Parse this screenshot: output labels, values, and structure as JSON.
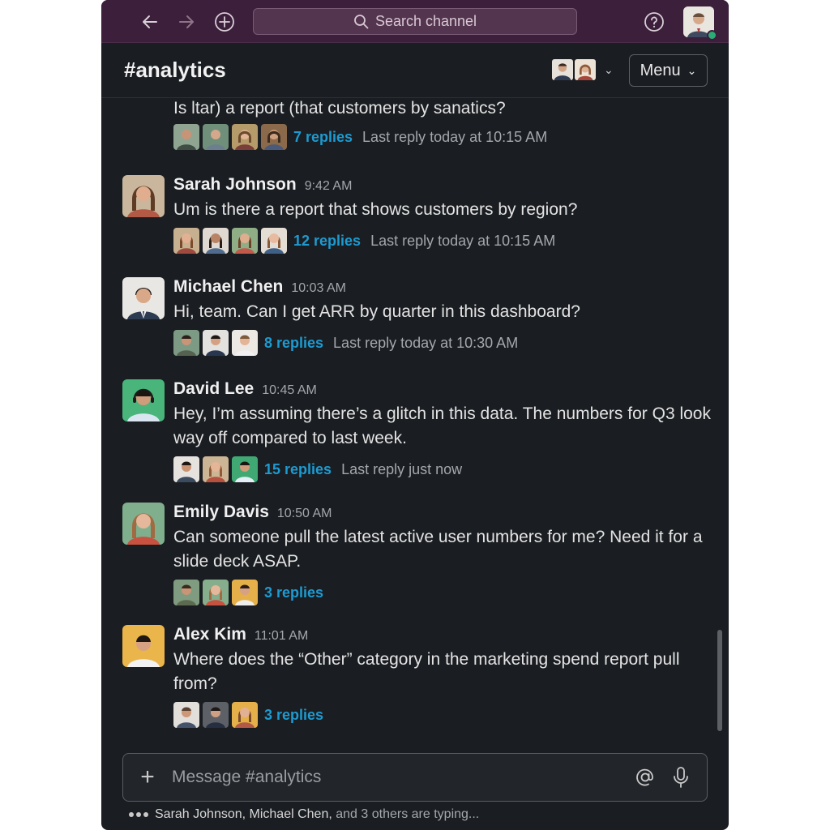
{
  "topbar": {
    "search_placeholder": "Search channel",
    "icons": [
      "arrow-left-icon",
      "arrow-right-icon",
      "plus-circle-icon",
      "search-icon",
      "help-icon"
    ]
  },
  "header": {
    "channel": "#analytics",
    "menu_label": "Menu"
  },
  "messages": [
    {
      "author": "",
      "time": "",
      "text": "Is ltar) a report (that customers by sanatics?",
      "replies": "7 replies",
      "last_reply": "Last reply today at 10:15 AM"
    },
    {
      "author": "Sarah Johnson",
      "time": "9:42 AM",
      "text": "Um is there a report that shows customers by region?",
      "replies": "12 replies",
      "last_reply": "Last reply today at 10:15 AM"
    },
    {
      "author": "Michael Chen",
      "time": "10:03 AM",
      "text": "Hi, team. Can I get ARR by quarter in this dashboard?",
      "replies": "8 replies",
      "last_reply": "Last reply today at 10:30 AM"
    },
    {
      "author": "David Lee",
      "time": "10:45 AM",
      "text": "Hey, I’m assuming there’s a glitch in this data. The numbers for Q3 look way off compared to last week.",
      "replies": "15 replies",
      "last_reply": "Last reply just now"
    },
    {
      "author": "Emily Davis",
      "time": "10:50 AM",
      "text": "Can someone pull the latest active user numbers for me? Need it for a slide deck ASAP.",
      "replies": "3 replies",
      "last_reply": ""
    },
    {
      "author": "Alex Kim",
      "time": "11:01 AM",
      "text": "Where does the “Other” category in the marketing spend report pull from?",
      "replies": "3 replies",
      "last_reply": ""
    }
  ],
  "composer": {
    "placeholder": "Message #analytics"
  },
  "typing": {
    "names": "Sarah Johnson, Michael Chen,",
    "rest": "and 3 others are typing..."
  },
  "colors": {
    "topbar": "#3b1f3b",
    "background": "#1a1d21",
    "link": "#1d9bd1",
    "presence": "#2bac76"
  }
}
